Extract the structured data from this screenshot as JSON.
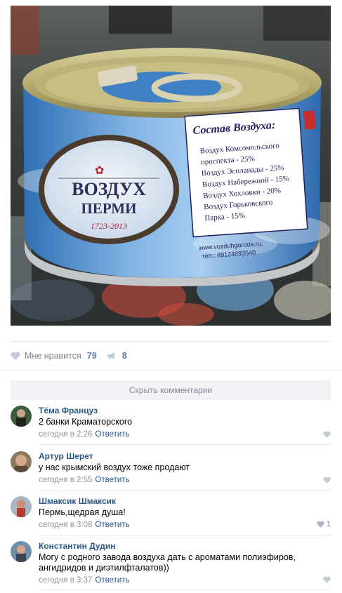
{
  "post_image": {
    "can_text": {
      "title_line1": "ВОЗДУХ",
      "title_line2": "ПЕРМИ",
      "years": "1723-2013",
      "composition_title": "Состав Воздуха:",
      "composition_lines": [
        "Воздух Комсомольского",
        "проспекта - 25%",
        "Воздух Эспланады - 25%",
        "Воздух Набережной - 15%",
        "Воздух Хохловки - 20%",
        "Воздух Горьковского",
        "Парка - 15%"
      ],
      "site": "www.vozduhgoroda.ru,",
      "phone": "тел.: 89124893540"
    }
  },
  "actions": {
    "like_label": "Мне нравится",
    "like_count": "79",
    "share_count": "8"
  },
  "hide_comments_label": "Скрыть комментарии",
  "comments": [
    {
      "author": "Тёма Француз",
      "text": "2 банки Краматорского",
      "time": "сегодня в 2:26",
      "reply": "Ответить",
      "likes": ""
    },
    {
      "author": "Артур Шерет",
      "text": "у нас крымский воздух тоже продают",
      "time": "сегодня в 2:55",
      "reply": "Ответить",
      "likes": ""
    },
    {
      "author": "Шмаксик Шмаксик",
      "text": "Пермь,щедрая душа!",
      "time": "сегодня в 3:08",
      "reply": "Ответить",
      "likes": "1"
    },
    {
      "author": "Константин Дудин",
      "text": "Могу с родного завода воздуха дать с ароматами полиэфиров, ангидридов и диэтилфталатов))",
      "time": "сегодня в 3:37",
      "reply": "Ответить",
      "likes": ""
    }
  ],
  "colors": {
    "link": "#2a5885",
    "meta": "#939393",
    "button_bg": "#f0f2f5",
    "divider": "#e7e8ec"
  }
}
